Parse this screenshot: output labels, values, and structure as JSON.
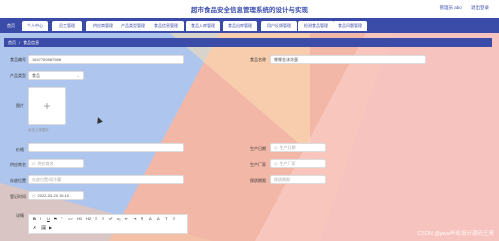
{
  "app": {
    "title": "超市食品安全信息管理系统的设计与实现",
    "user_label": "管理员 abo",
    "logout_label": "退出登录"
  },
  "nav": {
    "home": "首页",
    "items": [
      "个人中心",
      "员工管理",
      "供应商管理",
      "产品类型管理",
      "食品信息管理",
      "食品入库管理",
      "食品出库管理",
      "用户反馈管理",
      "检测食品管理",
      "食品问题管理"
    ]
  },
  "breadcrumb": {
    "root": "首页",
    "current": "食品信息"
  },
  "form": {
    "barcode_label": "食品编号",
    "barcode_value": "1647769987988",
    "name_label": "食品名称",
    "name_value": "哪哪金沫冻蛋",
    "type_label": "产品类型",
    "type_value": "食品",
    "image_label": "图片",
    "upload_hint": "点击上传图片",
    "price_label": "价格",
    "price_value": "",
    "production_date_label": "生产日期",
    "production_date_placeholder": "生产日期",
    "supplier_label": "供应商名",
    "supplier_placeholder": "供应商名",
    "manufacturer_label": "生产厂家",
    "manufacturer_placeholder": "生产厂家",
    "storage_label": "存放位置",
    "storage_placeholder": "存放位置/如冷藏",
    "shelf_label": "保质期限",
    "shelf_placeholder": "保质期限",
    "entry_time_label": "登记时间",
    "entry_time_value": "2022-03-20 15:10",
    "detail_label": "详情"
  },
  "editor": {
    "buttons": [
      "B",
      "I",
      "U",
      "S",
      "\"",
      "<>",
      "H1",
      "H2",
      "≡",
      "≡",
      "x²",
      "x₂",
      "⇤",
      "⇥",
      "¶",
      "A",
      "A",
      "T",
      "≡",
      "✗",
      "🖼",
      "▶"
    ]
  },
  "watermark": "CSDN @java毕业设计源码王哥",
  "colors": {
    "nav_bg": "#3a4ba8",
    "title": "#3d4fb0",
    "bg_blue": "#aec6ee",
    "bg_pink": "#f8c6bd"
  }
}
